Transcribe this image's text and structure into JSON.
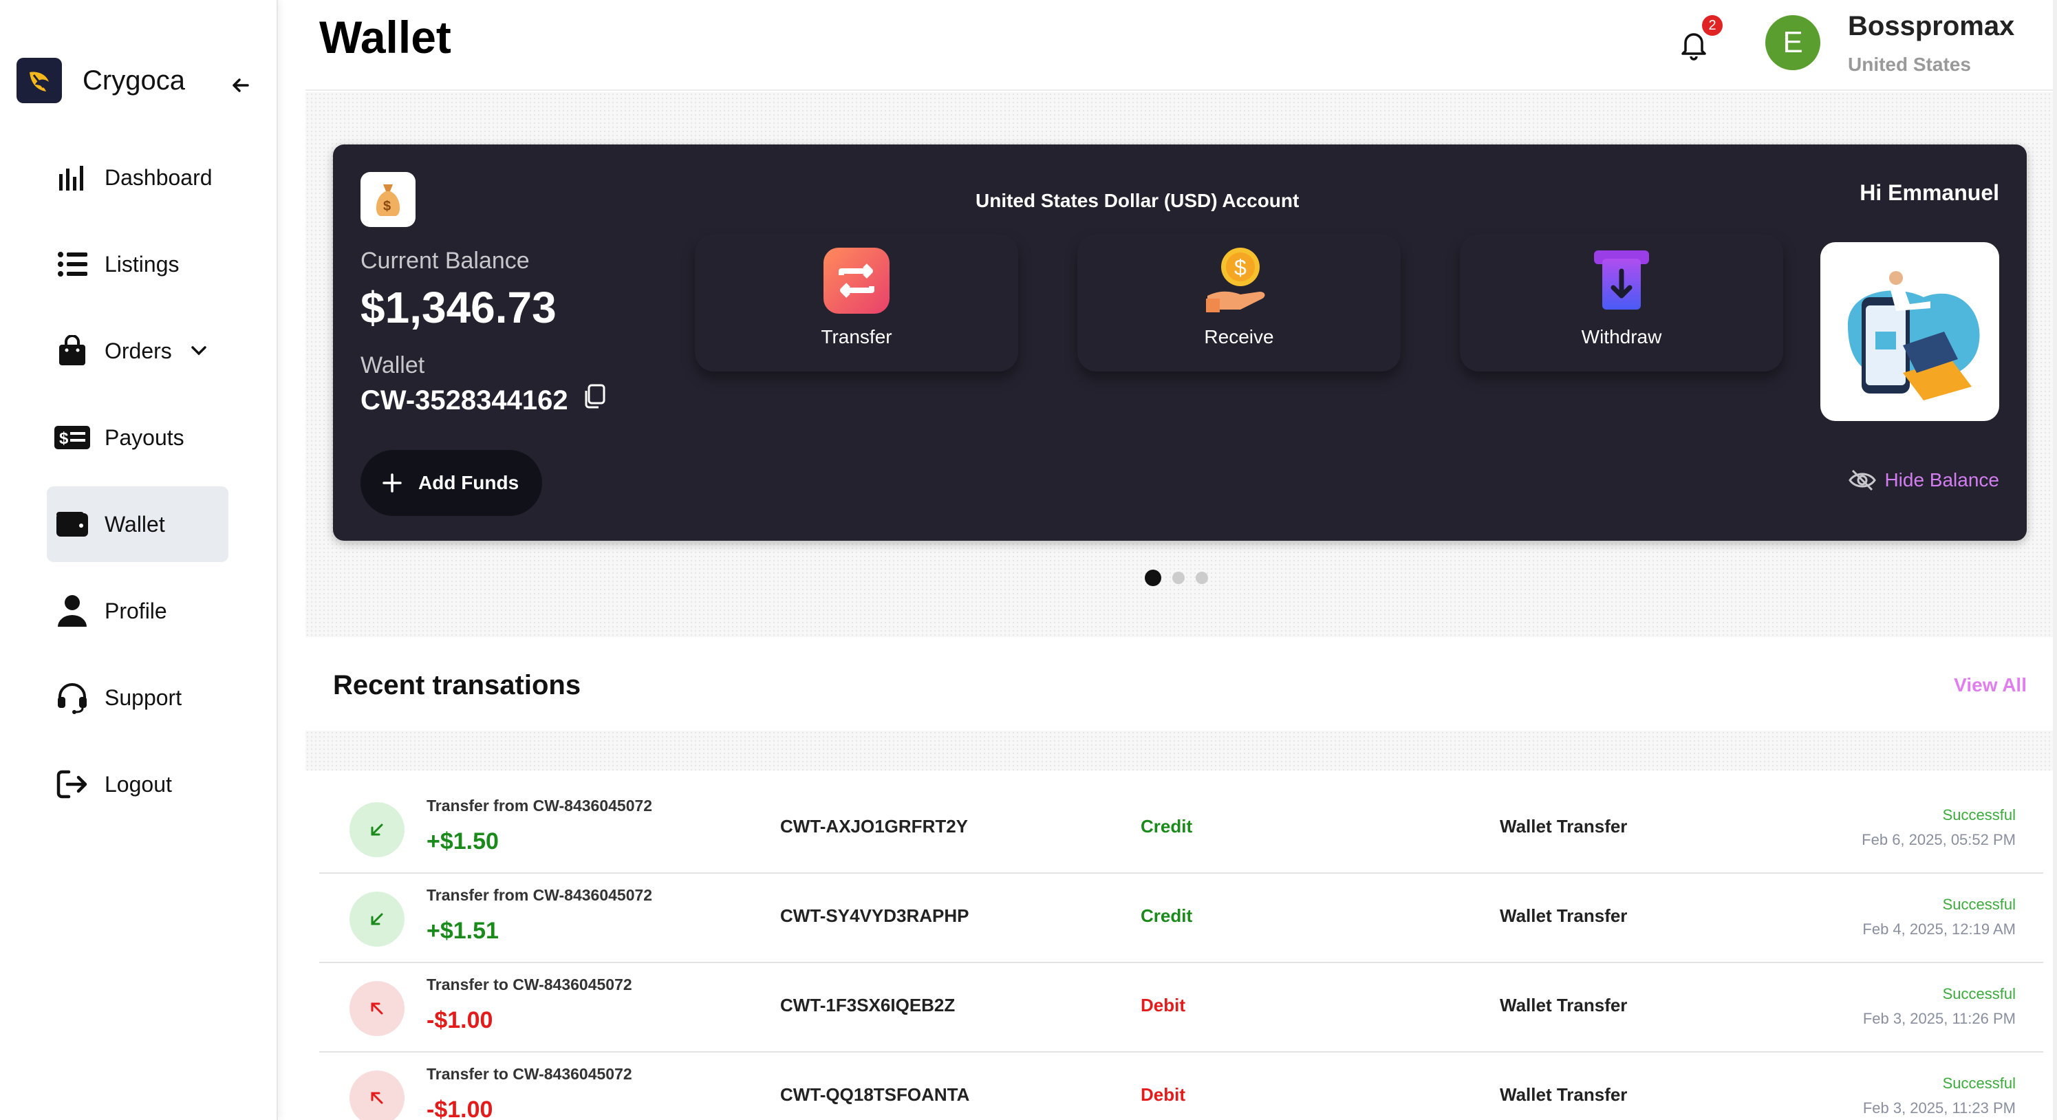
{
  "app": {
    "name": "Crygoca"
  },
  "sidebar": {
    "items": [
      {
        "label": "Dashboard"
      },
      {
        "label": "Listings"
      },
      {
        "label": "Orders"
      },
      {
        "label": "Payouts"
      },
      {
        "label": "Wallet"
      },
      {
        "label": "Profile"
      },
      {
        "label": "Support"
      },
      {
        "label": "Logout"
      }
    ],
    "active": "Wallet"
  },
  "header": {
    "title": "Wallet",
    "notifications_count": "2",
    "user": {
      "initial": "E",
      "name": "Bosspromax",
      "country": "United States"
    }
  },
  "wallet_card": {
    "account_title": "United States Dollar (USD) Account",
    "greeting": "Hi Emmanuel",
    "balance_label": "Current Balance",
    "balance": "$1,346.73",
    "wallet_label": "Wallet",
    "wallet_id": "CW-3528344162",
    "add_funds": "Add Funds",
    "hide_balance": "Hide Balance",
    "actions": [
      {
        "label": "Transfer",
        "icon": "transfer-icon"
      },
      {
        "label": "Receive",
        "icon": "receive-icon"
      },
      {
        "label": "Withdraw",
        "icon": "withdraw-icon"
      }
    ],
    "carousel": {
      "total": 3,
      "active": 0
    }
  },
  "transactions": {
    "title": "Recent transations",
    "view_all": "View All",
    "rows": [
      {
        "description": "Transfer from CW-8436045072",
        "amount": "+$1.50",
        "reference": "CWT-AXJO1GRFRT2Y",
        "type": "Credit",
        "category": "Wallet Transfer",
        "status": "Successful",
        "date": "Feb 6, 2025, 05:52 PM"
      },
      {
        "description": "Transfer from CW-8436045072",
        "amount": "+$1.51",
        "reference": "CWT-SY4VYD3RAPHP",
        "type": "Credit",
        "category": "Wallet Transfer",
        "status": "Successful",
        "date": "Feb 4, 2025, 12:19 AM"
      },
      {
        "description": "Transfer to CW-8436045072",
        "amount": "-$1.00",
        "reference": "CWT-1F3SX6IQEB2Z",
        "type": "Debit",
        "category": "Wallet Transfer",
        "status": "Successful",
        "date": "Feb 3, 2025, 11:26 PM"
      },
      {
        "description": "Transfer to CW-8436045072",
        "amount": "-$1.00",
        "reference": "CWT-QQ18TSFOANTA",
        "type": "Debit",
        "category": "Wallet Transfer",
        "status": "Successful",
        "date": "Feb 3, 2025, 11:23 PM"
      }
    ]
  },
  "colors": {
    "card_bg": "#23222e",
    "credit": "#1a8a1a",
    "debit": "#e31b1b",
    "accent_pink": "#d37ef0",
    "avatar": "#5a9e2f"
  }
}
